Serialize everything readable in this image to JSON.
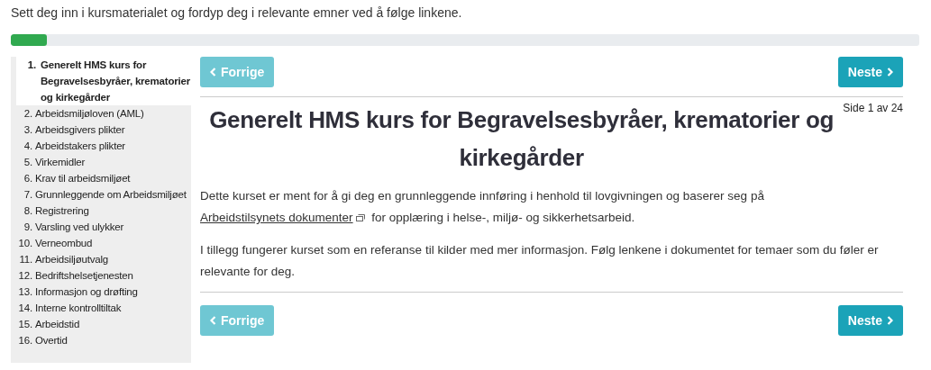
{
  "intro": "Sett deg inn i kursmaterialet og fordyp deg i relevante emner ved å følge linkene.",
  "progress": {
    "level": 0.04
  },
  "sidebar": {
    "items": [
      {
        "number": "1.",
        "label": "Generelt HMS kurs for Begravelsesbyråer, krematorier og kirkegårder",
        "selected": true
      },
      {
        "number": "2.",
        "label": "Arbeidsmiljøloven (AML)",
        "selected": false
      },
      {
        "number": "3.",
        "label": "Arbeidsgivers plikter",
        "selected": false
      },
      {
        "number": "4.",
        "label": "Arbeidstakers plikter",
        "selected": false
      },
      {
        "number": "5.",
        "label": "Virkemidler",
        "selected": false
      },
      {
        "number": "6.",
        "label": "Krav til arbeidsmiljøet",
        "selected": false
      },
      {
        "number": "7.",
        "label": "Grunnleggende om Arbeidsmiljøet",
        "selected": false
      },
      {
        "number": "8.",
        "label": "Registrering",
        "selected": false
      },
      {
        "number": "9.",
        "label": "Varsling ved ulykker",
        "selected": false
      },
      {
        "number": "10.",
        "label": "Verneombud",
        "selected": false
      },
      {
        "number": "11.",
        "label": "Arbeidsiljøutvalg",
        "selected": false
      },
      {
        "number": "12.",
        "label": "Bedriftshelsetjenesten",
        "selected": false
      },
      {
        "number": "13.",
        "label": "Informasjon og drøfting",
        "selected": false
      },
      {
        "number": "14.",
        "label": "Interne kontrolltiltak",
        "selected": false
      },
      {
        "number": "15.",
        "label": "Arbeidstid",
        "selected": false
      },
      {
        "number": "16.",
        "label": "Overtid",
        "selected": false
      }
    ]
  },
  "top_nav": [
    {
      "label": "Forrige",
      "kind": "prev",
      "disabled": true
    },
    {
      "label": "Neste",
      "kind": "next",
      "disabled": false
    }
  ],
  "title": "Generelt HMS kurs for Begravelsesbyråer, krematorier og kirkegårder",
  "page_counter": "Side 1 av 24",
  "paragraphs": [
    {
      "before": "Dette kurset er ment for å gi deg en grunnleggende innføring i henhold til lovgivningen og baserer seg på ",
      "link": "Arbeidstilsynets dokumenter",
      "after": " for opplæring i helse-, miljø- og sikkerhetsarbeid."
    },
    {
      "before": "I tillegg fungerer kurset som en referanse til kilder med mer informasjon. Følg lenkene i dokumentet for temaer som du føler er relevante for deg."
    }
  ],
  "bottom_nav": [
    {
      "label": "Forrige",
      "kind": "prev",
      "disabled": true
    },
    {
      "label": "Neste",
      "kind": "next",
      "disabled": false
    }
  ]
}
